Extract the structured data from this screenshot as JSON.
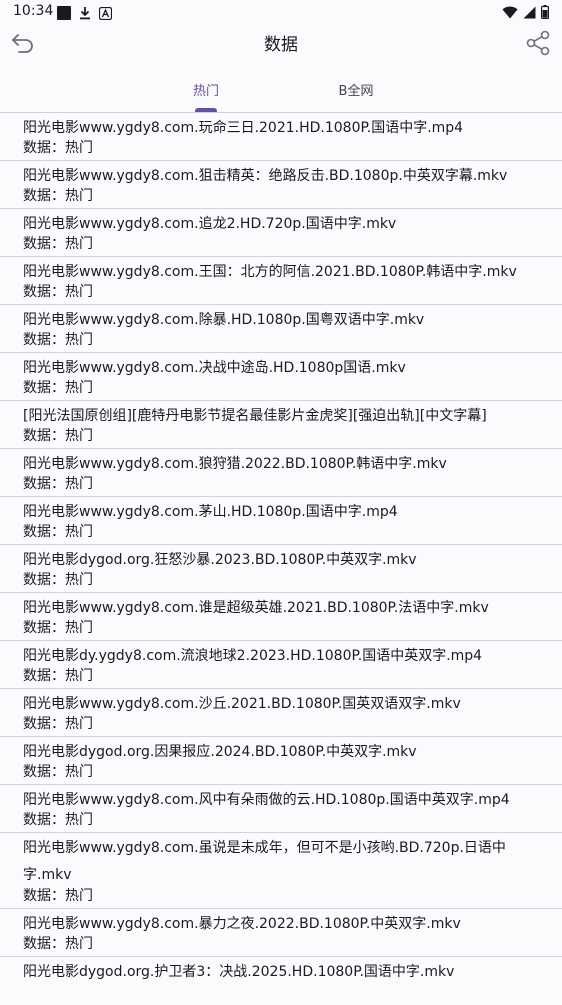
{
  "status_bar": {
    "time": "10:34"
  },
  "app_bar": {
    "title": "数据"
  },
  "tabs": [
    {
      "label": "热门",
      "active": true
    },
    {
      "label": "B全网",
      "active": false
    }
  ],
  "list": {
    "items": [
      {
        "title": "阳光电影www.ygdy8.com.玩命三日.2021.HD.1080P.国语中字.mp4",
        "sub": "数据：热门"
      },
      {
        "title": "阳光电影www.ygdy8.com.狙击精英：绝路反击.BD.1080p.中英双字幕.mkv",
        "sub": "数据：热门"
      },
      {
        "title": "阳光电影www.ygdy8.com.追龙2.HD.720p.国语中字.mkv",
        "sub": "数据：热门"
      },
      {
        "title": "阳光电影www.ygdy8.com.王国：北方的阿信.2021.BD.1080P.韩语中字.mkv",
        "sub": "数据：热门"
      },
      {
        "title": "阳光电影www.ygdy8.com.除暴.HD.1080p.国粤双语中字.mkv",
        "sub": "数据：热门"
      },
      {
        "title": "阳光电影www.ygdy8.com.决战中途岛.HD.1080p国语.mkv",
        "sub": "数据：热门"
      },
      {
        "title": "[阳光法国原创组][鹿特丹电影节提名最佳影片金虎奖][强迫出轨][中文字幕]",
        "sub": "数据：热门"
      },
      {
        "title": "阳光电影www.ygdy8.com.狼狩猎.2022.BD.1080P.韩语中字.mkv",
        "sub": "数据：热门"
      },
      {
        "title": "阳光电影www.ygdy8.com.茅山.HD.1080p.国语中字.mp4",
        "sub": "数据：热门"
      },
      {
        "title": "阳光电影dygod.org.狂怒沙暴.2023.BD.1080P.中英双字.mkv",
        "sub": "数据：热门"
      },
      {
        "title": "阳光电影www.ygdy8.com.谁是超级英雄.2021.BD.1080P.法语中字.mkv",
        "sub": "数据：热门"
      },
      {
        "title": "阳光电影dy.ygdy8.com.流浪地球2.2023.HD.1080P.国语中英双字.mp4",
        "sub": "数据：热门"
      },
      {
        "title": "阳光电影www.ygdy8.com.沙丘.2021.BD.1080P.国英双语双字.mkv",
        "sub": "数据：热门"
      },
      {
        "title": "阳光电影dygod.org.因果报应.2024.BD.1080P.中英双字.mkv",
        "sub": "数据：热门"
      },
      {
        "title": "阳光电影www.ygdy8.com.风中有朵雨做的云.HD.1080p.国语中英双字.mp4",
        "sub": "数据：热门"
      },
      {
        "title": "阳光电影www.ygdy8.com.虽说是未成年，但可不是小孩哟.BD.720p.日语中字.mkv",
        "sub": "数据：热门",
        "tall": true
      },
      {
        "title": "阳光电影www.ygdy8.com.暴力之夜.2022.BD.1080P.中英双字.mkv",
        "sub": "数据：热门"
      },
      {
        "title": "阳光电影dygod.org.护卫者3：决战.2025.HD.1080P.国语中字.mkv",
        "sub": ""
      }
    ]
  },
  "colors": {
    "accent": "#6750a4",
    "background": "#fbfafd",
    "divider": "#d2d2d8"
  },
  "icons": {
    "status_left": [
      "notification-square-icon",
      "download-icon",
      "font-a-icon"
    ],
    "status_right": [
      "wifi-icon",
      "signal-icon",
      "battery-icon"
    ],
    "back": "back-arrow-icon",
    "share": "share-icon"
  }
}
